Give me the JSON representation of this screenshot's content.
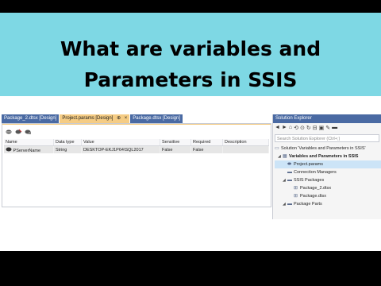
{
  "banner": {
    "line1": "What are variables and",
    "line2": "Parameters in SSIS",
    "color": "#7ed8e4"
  },
  "tabs": [
    {
      "label": "Package_2.dtsx [Design]"
    },
    {
      "label": "Project.params [Design]",
      "pin": "⊕",
      "close": "×"
    },
    {
      "label": "Package.dtsx [Design]"
    }
  ],
  "toolbar_icons": [
    "add-parameter-icon",
    "delete-parameter-icon",
    "add-to-config-icon"
  ],
  "grid": {
    "columns": [
      "Name",
      "Data type",
      "Value",
      "Sensitive",
      "Required",
      "Description"
    ],
    "rows": [
      {
        "name": "PServerName",
        "data_type": "String",
        "value": "DESKTOP-EKJ1P64\\SQL2017",
        "sensitive": "False",
        "required": "False",
        "description": ""
      }
    ]
  },
  "solution_explorer": {
    "title": "Solution Explorer",
    "search_placeholder": "Search Solution Explorer (Ctrl+;)",
    "tree": [
      {
        "label": "Solution 'Variables and Parameters in SSIS'"
      },
      {
        "label": "Variables and Parameters in SSIS"
      },
      {
        "label": "Project.params"
      },
      {
        "label": "Connection Managers"
      },
      {
        "label": "SSIS Packages"
      },
      {
        "label": "Package_2.dtsx"
      },
      {
        "label": "Package.dtsx"
      },
      {
        "label": "Package Parts"
      }
    ]
  }
}
